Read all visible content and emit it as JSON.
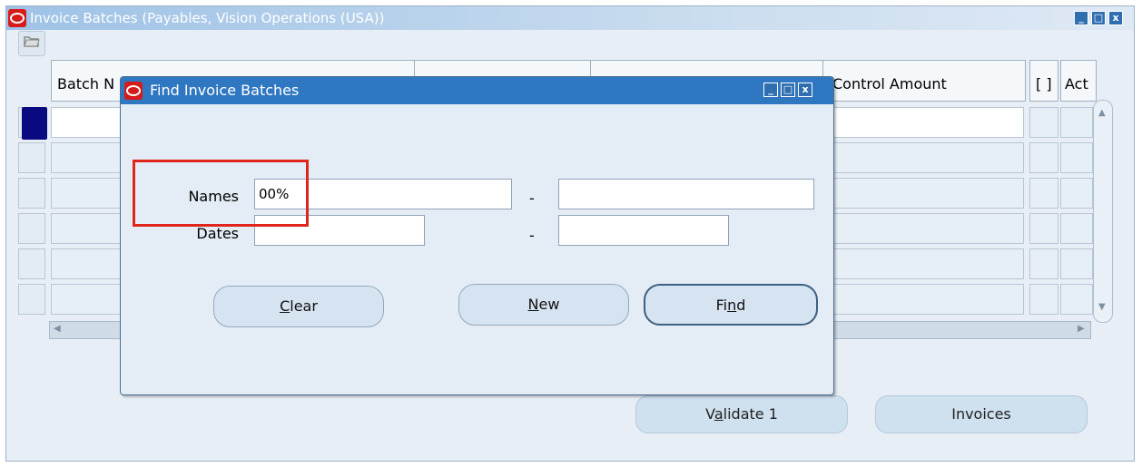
{
  "main_window": {
    "title": "Invoice Batches (Payables, Vision Operations (USA))",
    "controls": {
      "minimize": "_",
      "maximize": "□",
      "close": "x"
    },
    "toolbar_icon": "open-folder-icon"
  },
  "grid": {
    "columns": [
      "Batch N",
      "Control Amount",
      "[ ]",
      "Act"
    ]
  },
  "buttons": {
    "validate": {
      "prefix": "V",
      "mnemonic": "a",
      "suffix": "lidate 1"
    },
    "invoices": "Invoices"
  },
  "dialog": {
    "title": "Find Invoice Batches",
    "controls": {
      "minimize": "_",
      "maximize": "□",
      "close": "x"
    },
    "names_label": "Names",
    "dates_label": "Dates",
    "names_from_value": "00%",
    "names_to_value": "",
    "dates_from_value": "",
    "dates_to_value": "",
    "separator": "-",
    "clear": {
      "mnemonic": "C",
      "rest": "lear"
    },
    "new": {
      "mnemonic": "N",
      "rest": "ew"
    },
    "find": {
      "prefix": "Fi",
      "mnemonic": "n",
      "suffix": "d"
    }
  },
  "colors": {
    "dialog_title_bg": "#2f78c1",
    "main_title_bg": "#9ec2e6",
    "highlight_box": "#e0261c",
    "selected_row_indicator": "#0a0a80"
  }
}
